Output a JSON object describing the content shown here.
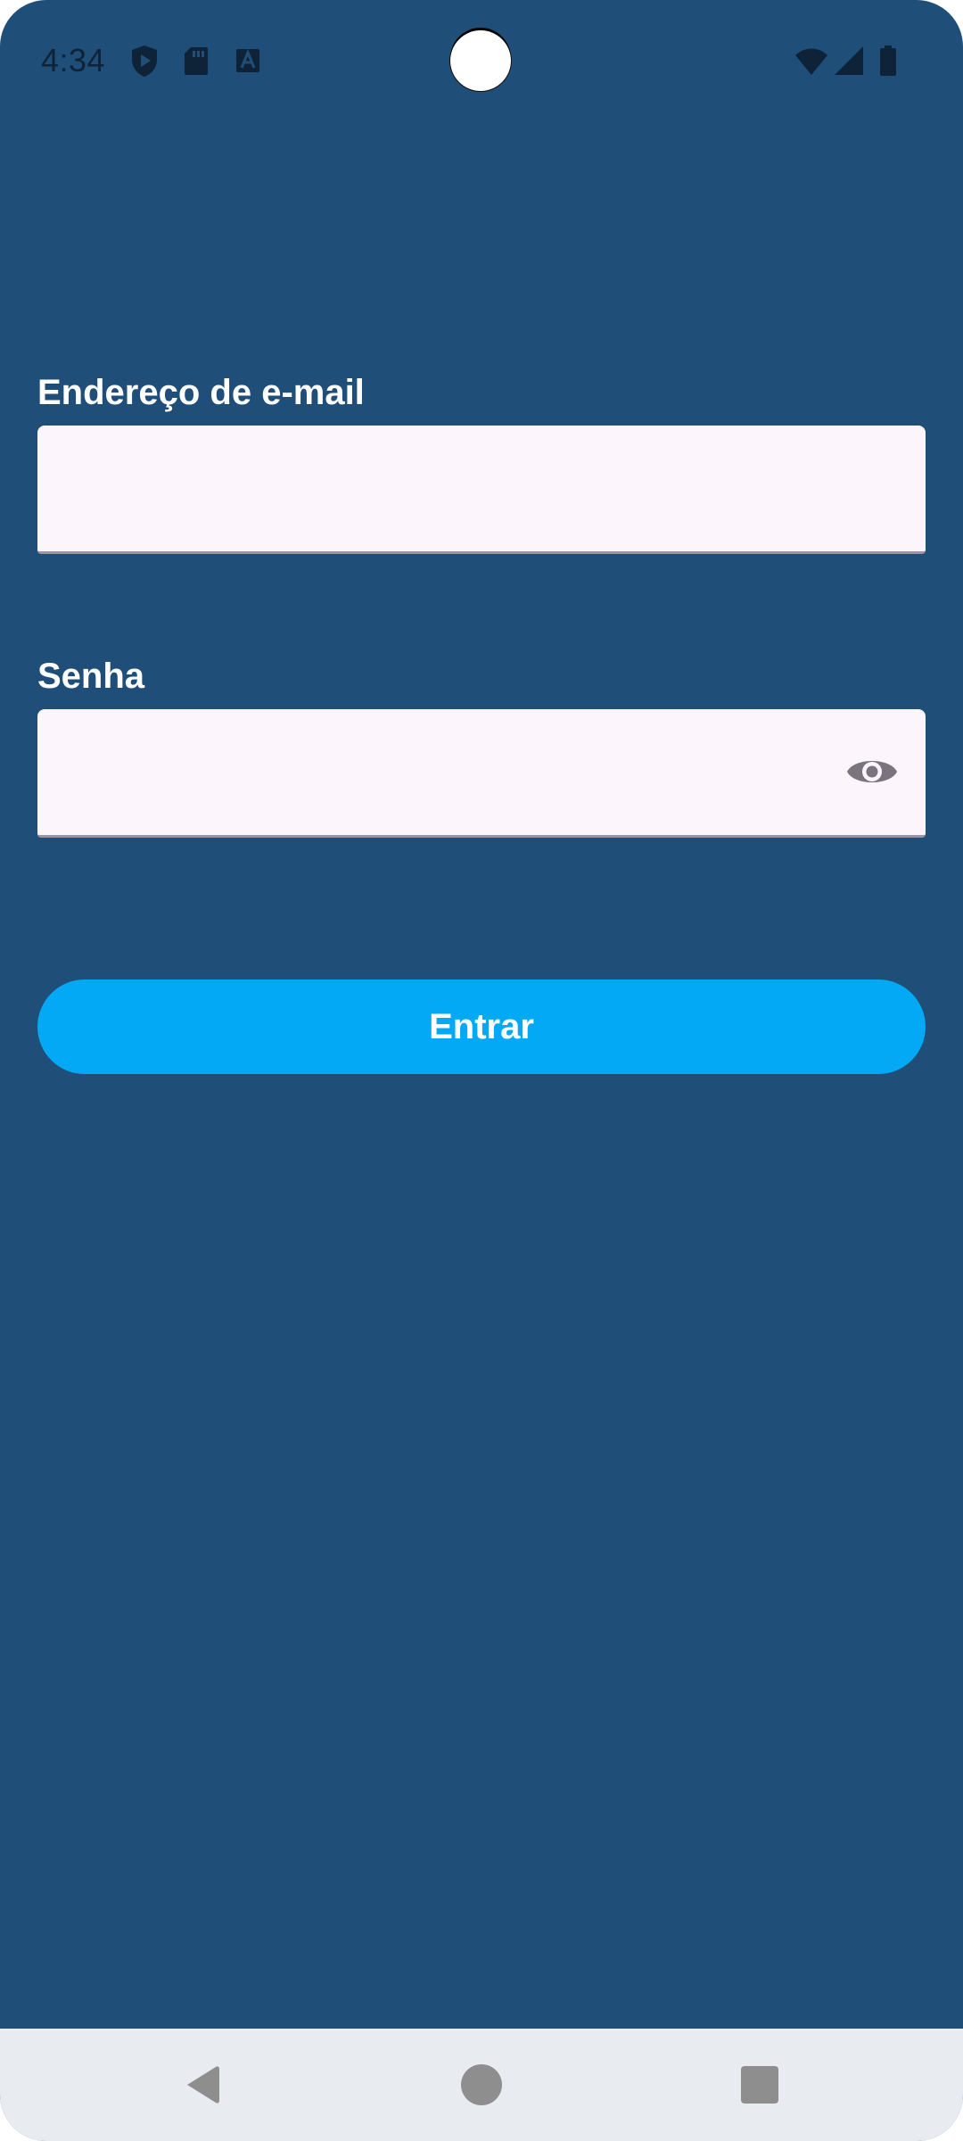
{
  "status_bar": {
    "time": "4:34",
    "icons": [
      "play-protect-icon",
      "sd-card-icon",
      "font-a-icon",
      "wifi-icon",
      "cellular-signal-icon",
      "battery-icon"
    ]
  },
  "form": {
    "email_label": "Endereço de e-mail",
    "email_value": "",
    "password_label": "Senha",
    "password_value": "",
    "submit_label": "Entrar"
  },
  "colors": {
    "background": "#1f4f79",
    "field_background": "#fcf6fc",
    "button": "#03a9f4",
    "nav_bar": "#e8ecf0"
  },
  "nav_bar": {
    "icons": [
      "back-icon",
      "home-icon",
      "recents-icon"
    ]
  }
}
